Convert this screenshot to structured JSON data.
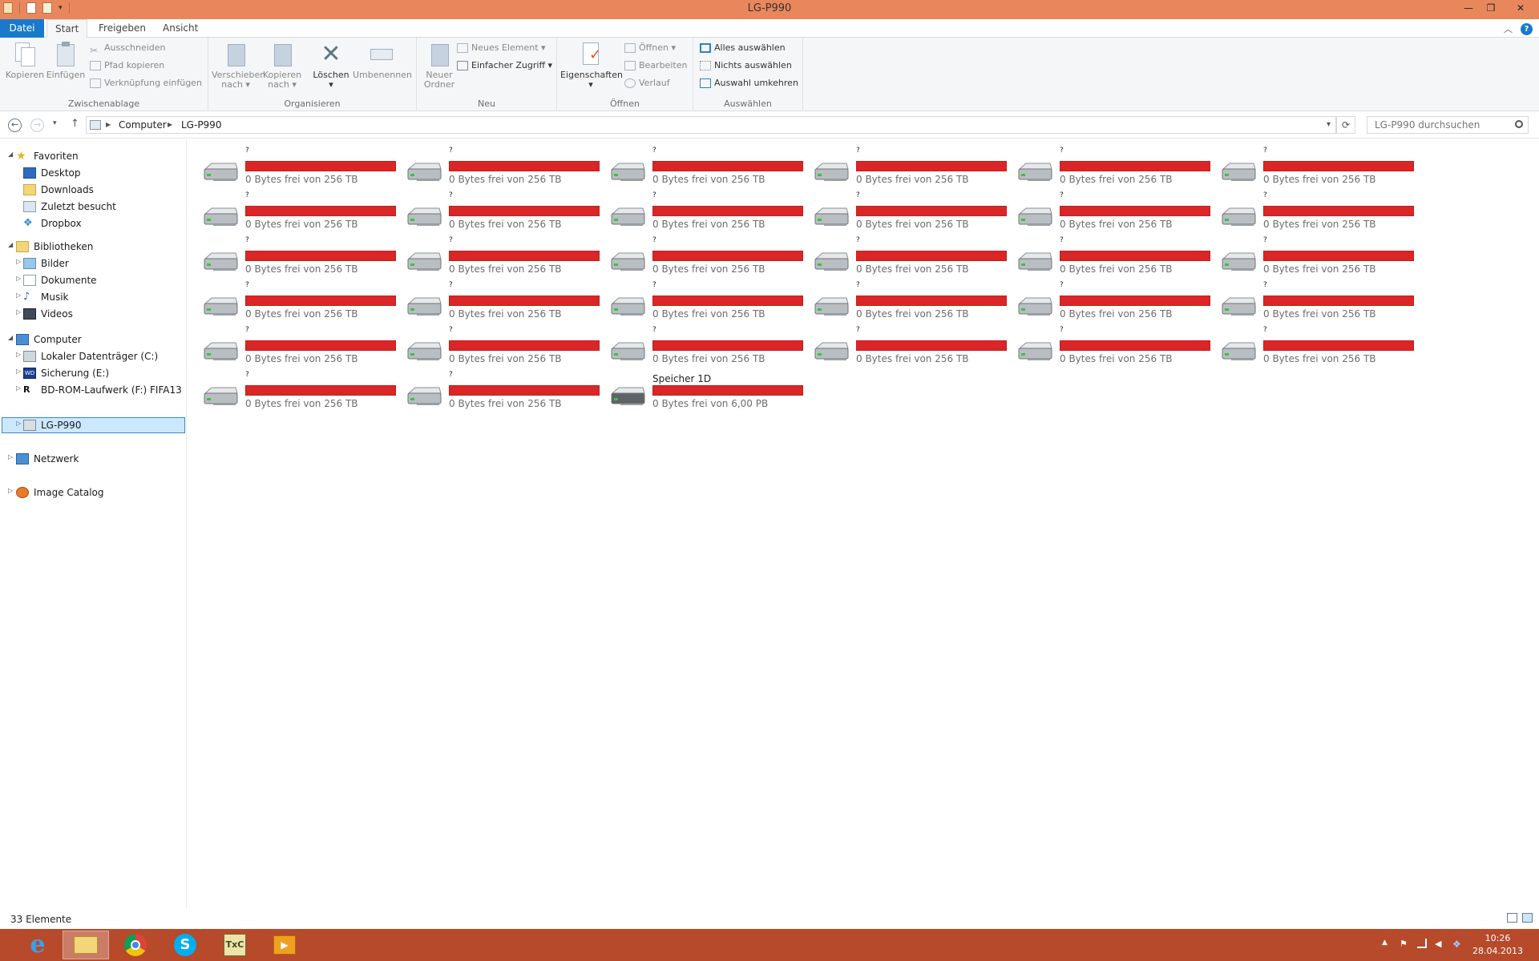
{
  "window": {
    "title": "LG-P990"
  },
  "ribbon_tabs": {
    "datei": "Datei",
    "start": "Start",
    "freigeben": "Freigeben",
    "ansicht": "Ansicht"
  },
  "ribbon": {
    "zwischenablage": {
      "kopieren": "Kopieren",
      "einfuegen": "Einfügen",
      "ausschneiden": "Ausschneiden",
      "pfad_kopieren": "Pfad kopieren",
      "verknuepfung": "Verknüpfung einfügen",
      "label": "Zwischenablage"
    },
    "organisieren": {
      "verschieben": [
        "Verschieben",
        "nach"
      ],
      "kopieren": [
        "Kopieren",
        "nach"
      ],
      "loeschen": "Löschen",
      "umbenennen": "Umbenennen",
      "label": "Organisieren"
    },
    "neu": {
      "neuer_ordner": [
        "Neuer",
        "Ordner"
      ],
      "neues_element": "Neues Element",
      "einfacher_zugriff": "Einfacher Zugriff",
      "label": "Neu"
    },
    "oeffnen": {
      "eigenschaften": "Eigenschaften",
      "oeffnen": "Öffnen",
      "bearbeiten": "Bearbeiten",
      "verlauf": "Verlauf",
      "label": "Öffnen"
    },
    "auswaehlen": {
      "alles": "Alles auswählen",
      "nichts": "Nichts auswählen",
      "umkehren": "Auswahl umkehren",
      "label": "Auswählen"
    }
  },
  "address": {
    "crumbs": [
      "Computer",
      "LG-P990"
    ],
    "search_placeholder": "LG-P990 durchsuchen"
  },
  "nav": {
    "favoriten": "Favoriten",
    "desktop": "Desktop",
    "downloads": "Downloads",
    "zuletzt": "Zuletzt besucht",
    "dropbox": "Dropbox",
    "bibliotheken": "Bibliotheken",
    "bilder": "Bilder",
    "dokumente": "Dokumente",
    "musik": "Musik",
    "videos": "Videos",
    "computer": "Computer",
    "lokal": "Lokaler Datenträger (C:)",
    "sicherung": "Sicherung (E:)",
    "bdrom": "BD-ROM-Laufwerk (F:) FIFA13",
    "lgp990": "LG-P990",
    "netzwerk": "Netzwerk",
    "imagecatalog": "Image Catalog"
  },
  "drives": {
    "unknown_name": "?",
    "unknown_size": "0 Bytes frei von 256 TB",
    "unknown_count": 32,
    "fill_used_fraction": 1.0,
    "last": {
      "name": "Speicher 1D",
      "size": "0 Bytes frei von 6,00 PB"
    }
  },
  "status": {
    "count": "33 Elemente"
  },
  "clock": {
    "time": "10:26",
    "date": "28.04.2013"
  },
  "colors": {
    "titlebar": "#e9875c",
    "taskbar": "#b74a2b",
    "accent": "#1979ca",
    "bar": "#da2626"
  }
}
